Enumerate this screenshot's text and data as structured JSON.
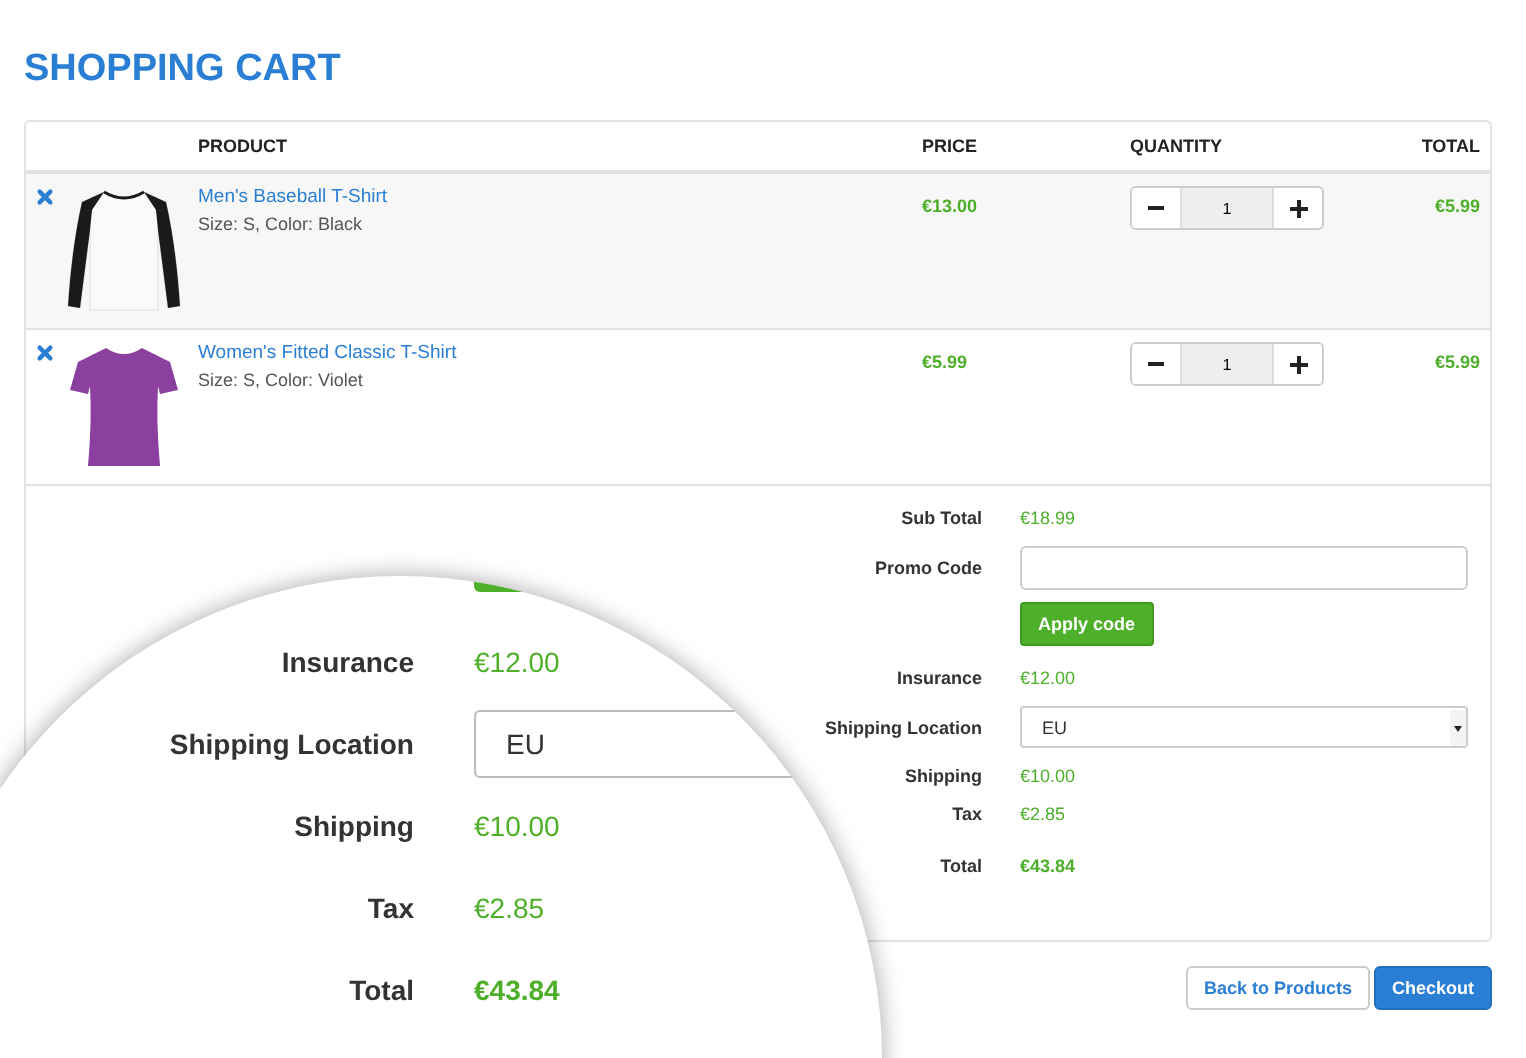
{
  "title": "SHOPPING CART",
  "table": {
    "columns": [
      "PRODUCT",
      "PRICE",
      "QUANTITY",
      "TOTAL"
    ],
    "rows": [
      {
        "kind": "raglan",
        "name": "Men's Baseball T-Shirt",
        "details": "Size: S, Color: Black",
        "price": "€13.00",
        "quantity": "1",
        "total": "€5.99"
      },
      {
        "kind": "tee",
        "name": "Women's Fitted Classic T-Shirt",
        "details": "Size: S, Color: Violet",
        "price": "€5.99",
        "quantity": "1",
        "total": "€5.99"
      }
    ]
  },
  "summary": {
    "sub_total": {
      "label": "Sub Total",
      "value": "€18.99"
    },
    "promo_code": {
      "label": "Promo Code",
      "button": "Apply code"
    },
    "insurance": {
      "label": "Insurance",
      "value": "€12.00"
    },
    "shipping_location": {
      "label": "Shipping Location",
      "value": "EU"
    },
    "shipping": {
      "label": "Shipping",
      "value": "€10.00"
    },
    "tax": {
      "label": "Tax",
      "value": "€2.85"
    },
    "total": {
      "label": "Total",
      "value": "€43.84"
    }
  },
  "magnifier": {
    "rows": [
      {
        "kind": "text",
        "label": "Insurance",
        "value": "€12.00"
      },
      {
        "kind": "select",
        "label": "Shipping Location",
        "value": "EU"
      },
      {
        "kind": "text",
        "label": "Shipping",
        "value": "€10.00"
      },
      {
        "kind": "text",
        "label": "Tax",
        "value": "€2.85"
      },
      {
        "kind": "total",
        "label": "Total",
        "value": "€43.84"
      }
    ]
  },
  "buttons": {
    "back": "Back to Products",
    "checkout": "Checkout"
  }
}
